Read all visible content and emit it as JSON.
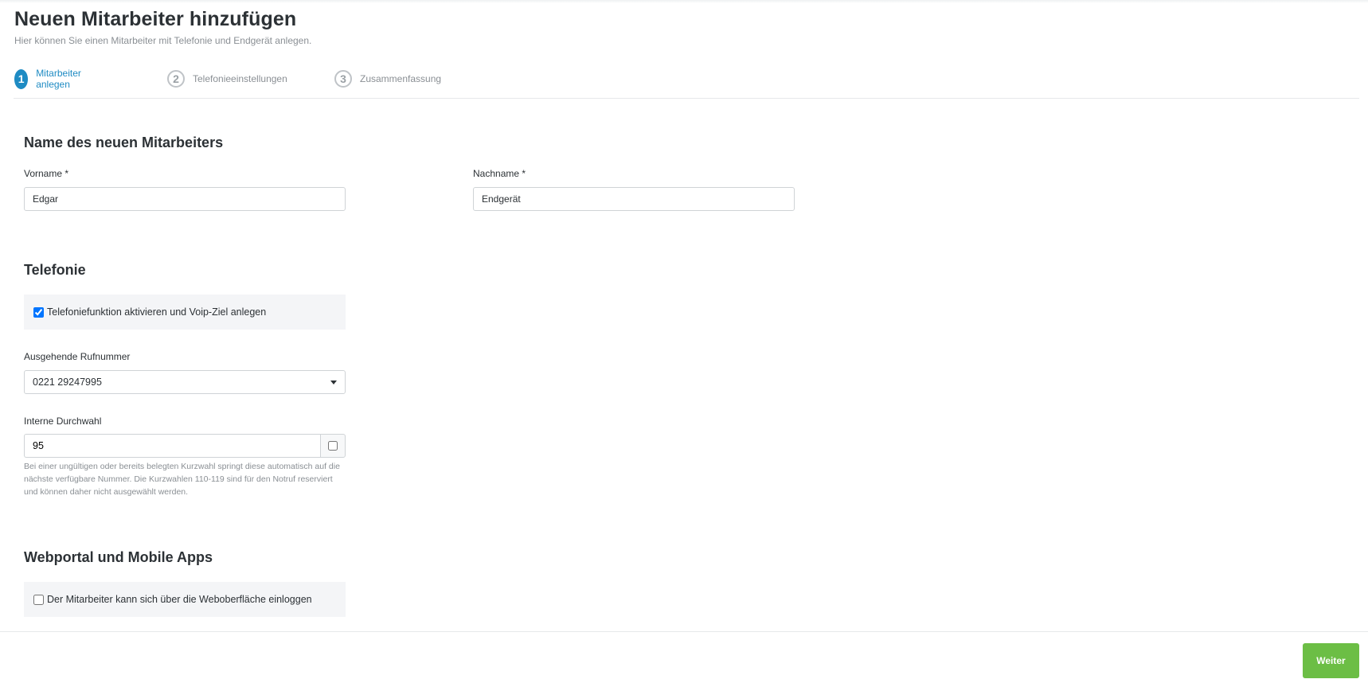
{
  "header": {
    "title": "Neuen Mitarbeiter hinzufügen",
    "subtitle": "Hier können Sie einen Mitarbeiter mit Telefonie und Endgerät anlegen."
  },
  "steps": [
    {
      "number": "1",
      "label": "Mitarbeiter anlegen",
      "active": true
    },
    {
      "number": "2",
      "label": "Telefonieeinstellungen",
      "active": false
    },
    {
      "number": "3",
      "label": "Zusammenfassung",
      "active": false
    }
  ],
  "name_section": {
    "title": "Name des neuen Mitarbeiters",
    "firstname_label": "Vorname",
    "firstname_value": "Edgar",
    "lastname_label": "Nachname",
    "lastname_value": "Endgerät",
    "required_marker": "*"
  },
  "telephony": {
    "title": "Telefonie",
    "enable_label": "Telefoniefunktion aktivieren und Voip-Ziel anlegen",
    "enable_checked": true,
    "outgoing_label": "Ausgehende Rufnummer",
    "outgoing_value": "0221 29247995",
    "extension_label": "Interne Durchwahl",
    "extension_value": "95",
    "help_text": "Bei einer ungültigen oder bereits belegten Kurzwahl springt diese automatisch auf die nächste verfügbare Nummer. Die Kurzwahlen 110-119 sind für den Notruf reserviert und können daher nicht ausgewählt werden."
  },
  "webportal": {
    "title": "Webportal und Mobile Apps",
    "login_label": "Der Mitarbeiter kann sich über die Weboberfläche einloggen",
    "login_checked": false
  },
  "footer": {
    "next_label": "Weiter",
    "next_color": "#6cbe45"
  },
  "colors": {
    "accent": "#1e8bc3",
    "muted": "#8a8f94"
  }
}
